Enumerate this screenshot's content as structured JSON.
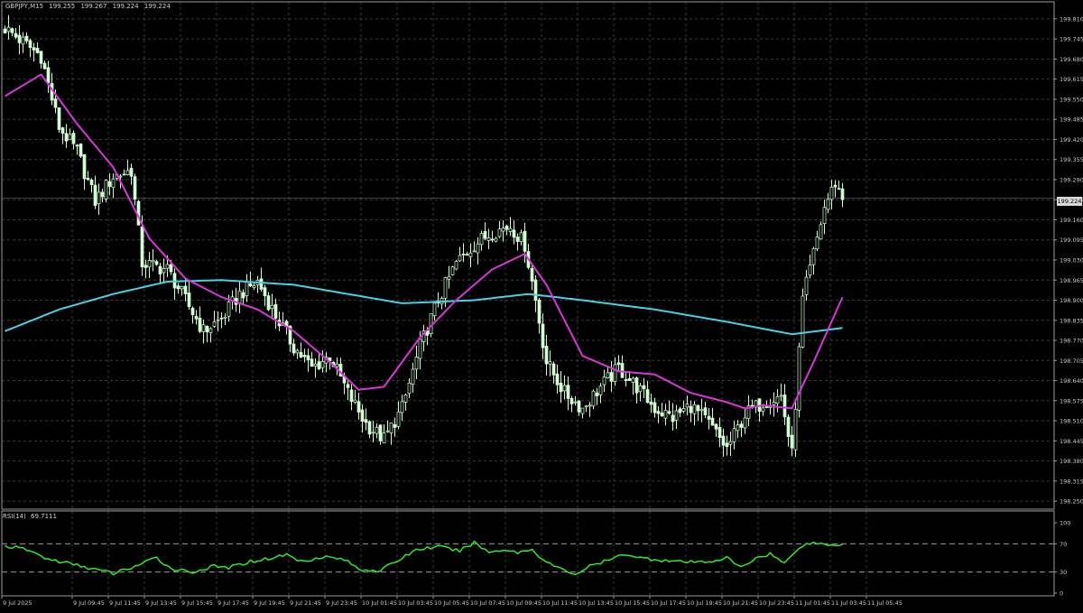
{
  "header": {
    "symbol": "GBPJPY,M15",
    "open": "199.255",
    "high": "199.267",
    "low": "199.224",
    "close": "199.224"
  },
  "price_tag": "199.224",
  "rsi_header": {
    "name": "RSI(14)",
    "value": "69.7111"
  },
  "colors": {
    "background": "#000000",
    "grid": "#3a3a3a",
    "candle": "#d2ffd2",
    "ma_fast": "#d936d9",
    "ma_slow": "#46d2e6",
    "rsi": "#32e632"
  },
  "chart_data": [
    {
      "type": "candlestick",
      "symbol": "GBPJPY",
      "timeframe": "M15",
      "y_ticks": [
        "199.810",
        "199.745",
        "199.680",
        "199.615",
        "199.550",
        "199.485",
        "199.420",
        "199.355",
        "199.290",
        "199.225",
        "199.160",
        "199.095",
        "199.030",
        "198.965",
        "198.900",
        "198.835",
        "198.770",
        "198.705",
        "198.640",
        "198.575",
        "198.510",
        "198.445",
        "198.380",
        "198.315",
        "198.250"
      ],
      "ylim": [
        198.224,
        199.836
      ],
      "x_ticks": [
        "9 Jul 2025",
        "9 Jul 09:45",
        "9 Jul 11:45",
        "9 Jul 13:45",
        "9 Jul 15:45",
        "9 Jul 17:45",
        "9 Jul 19:45",
        "9 Jul 21:45",
        "9 Jul 23:45",
        "10 Jul 01:45",
        "10 Jul 03:45",
        "10 Jul 05:45",
        "10 Jul 07:45",
        "10 Jul 09:45",
        "10 Jul 11:45",
        "10 Jul 13:45",
        "10 Jul 15:45",
        "10 Jul 17:45",
        "10 Jul 19:45",
        "10 Jul 21:45",
        "10 Jul 23:45",
        "11 Jul 01:45",
        "11 Jul 03:45",
        "11 Jul 05:45"
      ],
      "close_anchors": [
        [
          0,
          199.78
        ],
        [
          10,
          199.69
        ],
        [
          15,
          199.46
        ],
        [
          20,
          199.38
        ],
        [
          25,
          199.22
        ],
        [
          30,
          199.3
        ],
        [
          35,
          199.32
        ],
        [
          38,
          199.02
        ],
        [
          45,
          199.0
        ],
        [
          50,
          198.9
        ],
        [
          55,
          198.8
        ],
        [
          60,
          198.84
        ],
        [
          65,
          198.92
        ],
        [
          70,
          198.96
        ],
        [
          75,
          198.85
        ],
        [
          80,
          198.75
        ],
        [
          85,
          198.68
        ],
        [
          90,
          198.72
        ],
        [
          95,
          198.6
        ],
        [
          100,
          198.5
        ],
        [
          105,
          198.45
        ],
        [
          110,
          198.55
        ],
        [
          115,
          198.75
        ],
        [
          120,
          198.9
        ],
        [
          125,
          199.02
        ],
        [
          130,
          199.08
        ],
        [
          135,
          199.12
        ],
        [
          140,
          199.14
        ],
        [
          144,
          199.08
        ],
        [
          147,
          198.9
        ],
        [
          150,
          198.7
        ],
        [
          155,
          198.6
        ],
        [
          160,
          198.55
        ],
        [
          165,
          198.62
        ],
        [
          170,
          198.68
        ],
        [
          175,
          198.62
        ],
        [
          180,
          198.55
        ],
        [
          185,
          198.52
        ],
        [
          190,
          198.56
        ],
        [
          195,
          198.5
        ],
        [
          200,
          198.42
        ],
        [
          205,
          198.53
        ],
        [
          210,
          198.57
        ],
        [
          215,
          198.59
        ],
        [
          218,
          198.4
        ],
        [
          221,
          198.9
        ],
        [
          224,
          199.05
        ],
        [
          227,
          199.2
        ],
        [
          230,
          199.28
        ],
        [
          232,
          199.23
        ]
      ],
      "ma_fast_anchors": [
        [
          0,
          199.56
        ],
        [
          10,
          199.63
        ],
        [
          20,
          199.47
        ],
        [
          30,
          199.33
        ],
        [
          40,
          199.1
        ],
        [
          50,
          198.97
        ],
        [
          60,
          198.91
        ],
        [
          70,
          198.87
        ],
        [
          80,
          198.8
        ],
        [
          90,
          198.7
        ],
        [
          98,
          198.61
        ],
        [
          105,
          198.62
        ],
        [
          115,
          198.78
        ],
        [
          125,
          198.9
        ],
        [
          135,
          199.0
        ],
        [
          144,
          199.05
        ],
        [
          150,
          198.95
        ],
        [
          160,
          198.72
        ],
        [
          170,
          198.67
        ],
        [
          180,
          198.66
        ],
        [
          190,
          198.6
        ],
        [
          200,
          198.57
        ],
        [
          205,
          198.55
        ],
        [
          210,
          198.56
        ],
        [
          218,
          198.55
        ],
        [
          224,
          198.7
        ],
        [
          232,
          198.91
        ]
      ],
      "ma_slow_anchors": [
        [
          0,
          198.8
        ],
        [
          15,
          198.87
        ],
        [
          30,
          198.92
        ],
        [
          45,
          198.96
        ],
        [
          60,
          198.965
        ],
        [
          80,
          198.95
        ],
        [
          100,
          198.91
        ],
        [
          110,
          198.89
        ],
        [
          130,
          198.9
        ],
        [
          145,
          198.92
        ],
        [
          160,
          198.9
        ],
        [
          180,
          198.87
        ],
        [
          200,
          198.83
        ],
        [
          218,
          198.79
        ],
        [
          232,
          198.81
        ]
      ],
      "bar_count": 233
    },
    {
      "type": "line",
      "name": "RSI(14)",
      "levels": [
        70,
        30
      ],
      "y_ticks": [
        "100",
        "70",
        "30",
        "0"
      ],
      "ylim": [
        0,
        100
      ],
      "rsi_anchors": [
        [
          0,
          67
        ],
        [
          6,
          62
        ],
        [
          12,
          48
        ],
        [
          18,
          42
        ],
        [
          24,
          35
        ],
        [
          30,
          28
        ],
        [
          36,
          38
        ],
        [
          42,
          50
        ],
        [
          46,
          35
        ],
        [
          52,
          30
        ],
        [
          58,
          38
        ],
        [
          62,
          36
        ],
        [
          68,
          45
        ],
        [
          74,
          50
        ],
        [
          78,
          55
        ],
        [
          82,
          45
        ],
        [
          88,
          52
        ],
        [
          94,
          48
        ],
        [
          98,
          34
        ],
        [
          104,
          32
        ],
        [
          110,
          50
        ],
        [
          114,
          62
        ],
        [
          120,
          66
        ],
        [
          126,
          60
        ],
        [
          130,
          72
        ],
        [
          134,
          58
        ],
        [
          138,
          62
        ],
        [
          142,
          58
        ],
        [
          146,
          62
        ],
        [
          150,
          44
        ],
        [
          154,
          34
        ],
        [
          158,
          27
        ],
        [
          162,
          38
        ],
        [
          168,
          48
        ],
        [
          172,
          56
        ],
        [
          176,
          50
        ],
        [
          182,
          47
        ],
        [
          188,
          44
        ],
        [
          194,
          44
        ],
        [
          200,
          50
        ],
        [
          204,
          36
        ],
        [
          208,
          50
        ],
        [
          212,
          56
        ],
        [
          216,
          42
        ],
        [
          220,
          66
        ],
        [
          224,
          72
        ],
        [
          228,
          68
        ],
        [
          232,
          70
        ]
      ],
      "last_value": 69.7111
    }
  ]
}
